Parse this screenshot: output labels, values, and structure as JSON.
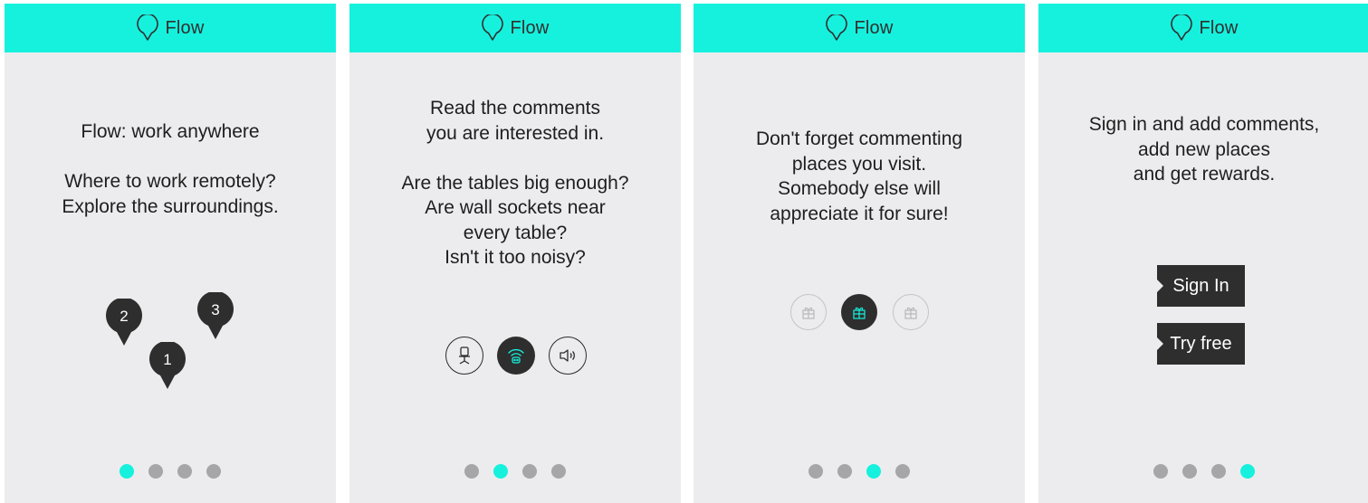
{
  "app_name": "Flow",
  "colors": {
    "accent": "#16f1de",
    "dark": "#2e2e2e",
    "inactive_dot": "#a6a6a8",
    "background": "#ececee"
  },
  "screens": [
    {
      "lines": [
        "Flow: work anywhere",
        "",
        "Where to work remotely?",
        "Explore the surroundings."
      ],
      "pins": [
        "2",
        "3",
        "1"
      ],
      "active_page": 1
    },
    {
      "lines": [
        "Read the comments",
        "you are interested in.",
        "",
        "Are the tables big enough?",
        "Are wall sockets near",
        "every table?",
        "Isn't it too noisy?"
      ],
      "icons": [
        "chair-icon",
        "wifi-icon",
        "speaker-icon"
      ],
      "active_page": 2
    },
    {
      "lines": [
        "Don't forget commenting",
        "places you visit.",
        "Somebody else will",
        "appreciate it for sure!"
      ],
      "icons": [
        "gift-icon",
        "gift-icon",
        "gift-icon"
      ],
      "active_page": 3
    },
    {
      "lines": [
        "Sign in and add comments,",
        "add new places",
        "and get rewards."
      ],
      "sign_in_label": "Sign In",
      "try_free_label": "Try free",
      "active_page": 4
    }
  ]
}
